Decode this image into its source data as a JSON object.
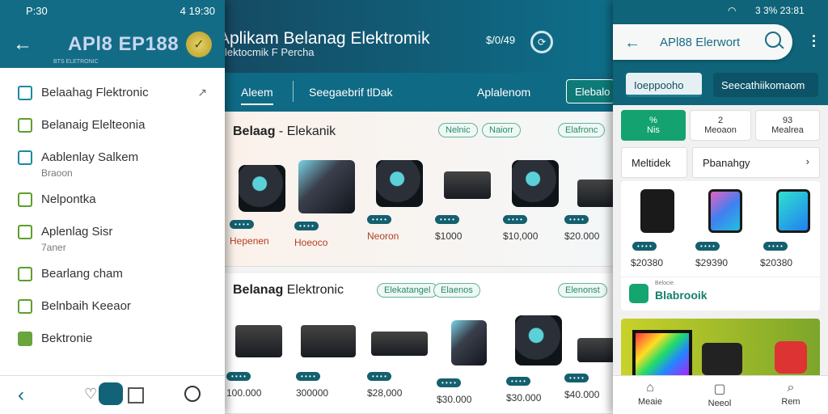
{
  "left": {
    "status_time": "P:30",
    "status_right": "4 19:30",
    "app_title": "APl8 EP188",
    "app_sub": "BTS ELETRONIC",
    "menu": [
      {
        "label": "Belaahag Flektronic",
        "sub": "",
        "icon": "grid-icon",
        "chevron": true
      },
      {
        "label": "Belanaig Elelteonia",
        "sub": "",
        "icon": "battery-icon",
        "chevron": false
      },
      {
        "label": "Aablenlay Salkem",
        "sub": "Braoon",
        "icon": "monitor-icon",
        "chevron": false
      },
      {
        "label": "Nelpontka",
        "sub": "",
        "icon": "phone-icon",
        "chevron": false
      },
      {
        "label": "Aplenlag Sisr",
        "sub": "7aner",
        "icon": "tablet-icon",
        "chevron": false
      },
      {
        "label": "Bearlang cham",
        "sub": "",
        "icon": "case-icon",
        "chevron": false
      },
      {
        "label": "Belnbaih Keeaor",
        "sub": "",
        "icon": "doc-icon",
        "chevron": false
      },
      {
        "label": "Bektronie",
        "sub": "",
        "icon": "robot-icon",
        "chevron": false
      }
    ]
  },
  "center": {
    "title": "Aplikam Belanag Elektromik",
    "subtitle": "lektocmik F Percha",
    "code": "$/0/49",
    "tabs": [
      "Aleem",
      "Seegaebrif tlDak",
      "Aplalenom"
    ],
    "action_button": "Elebalo",
    "panel1": {
      "title_bold": "Belaag",
      "title_rest": "- Elekanik",
      "chips": [
        "Nelnic",
        "Naiorr",
        "Elafronc"
      ],
      "products": [
        {
          "badge": "• • • •",
          "price": "Hepenen"
        },
        {
          "badge": "• • • •",
          "price": "Hoeoco"
        },
        {
          "badge": "• • • •",
          "price": "Neoron"
        },
        {
          "badge": "• • • •",
          "price": "$1000"
        },
        {
          "badge": "• • • •",
          "price": "$10,000"
        },
        {
          "badge": "• • • •",
          "price": "$20.000"
        }
      ]
    },
    "panel2": {
      "title_bold": "Belanag",
      "title_rest": "Elektronic",
      "chips": [
        "Elekatangel",
        "Elaenos",
        "Elenonst"
      ],
      "products": [
        {
          "badge": "• • • •",
          "price": "100.000"
        },
        {
          "badge": "• • • •",
          "price": "300000"
        },
        {
          "badge": "• • • •",
          "price": "$28,000"
        },
        {
          "badge": "• • • •",
          "price": "$30.000"
        },
        {
          "badge": "• • • •",
          "price": "$30.000"
        },
        {
          "badge": "• • • •",
          "price": "$40.000"
        }
      ]
    }
  },
  "right": {
    "status_right": "3 3% 23:81",
    "search_text": "APl88 Elerwort",
    "tabs": [
      "Ioeppooho",
      "Seecathiikomaom"
    ],
    "quick_cards": [
      {
        "top": "%",
        "bottom": "Nis"
      },
      {
        "top": "2",
        "bottom": "Meoaon"
      },
      {
        "top": "93",
        "bottom": "Mealrea"
      }
    ],
    "filters": [
      "Meltidek",
      "Pbanahgy"
    ],
    "phones": [
      {
        "price": "$20380"
      },
      {
        "price": "$29390"
      },
      {
        "price": "$20380"
      }
    ],
    "store_sm": "Belocie",
    "store_name": "Blabrooik",
    "bottom_nav": [
      "Meaie",
      "Neeol",
      "Rem"
    ]
  }
}
